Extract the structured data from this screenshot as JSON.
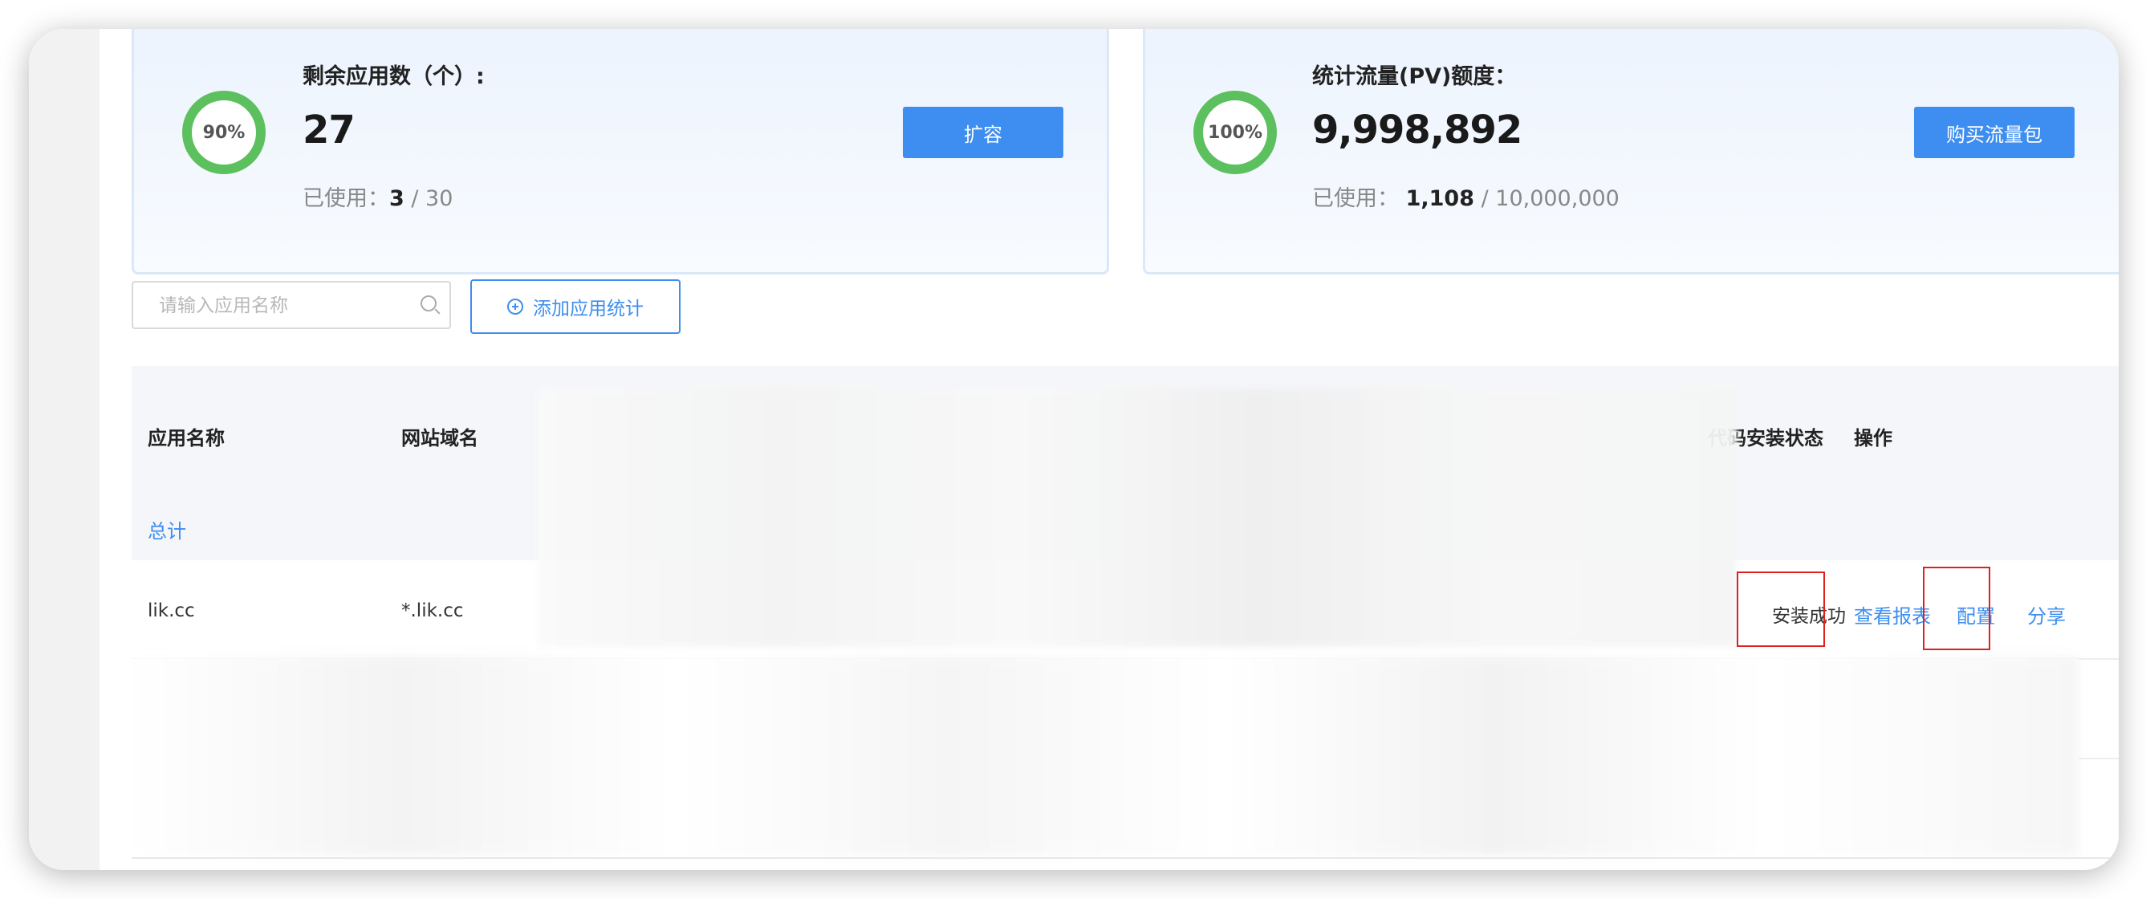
{
  "apps_card": {
    "percent": "90%",
    "title": "剩余应用数（个）:",
    "value": "27",
    "used_label": "已使用：",
    "used": "3",
    "total": " / 30",
    "button": "扩容"
  },
  "pv_card": {
    "percent": "100%",
    "title": "统计流量(PV)额度：",
    "value": "9,998,892",
    "used_label": "已使用：",
    "used": "1,108",
    "total": " / 10,000,000",
    "button": "购买流量包"
  },
  "toolbar": {
    "search_placeholder": "请输入应用名称",
    "add_button": "添加应用统计"
  },
  "table": {
    "headers": {
      "app_name": "应用名称",
      "domain": "网站域名",
      "install_status": "代码安装状态",
      "actions": "操作"
    },
    "total_label": "总计",
    "rows": [
      {
        "app_name": "lik.cc",
        "domain": "*.lik.cc",
        "status": "安装成功",
        "actions": {
          "report": "查看报表",
          "config": "配置",
          "share": "分享"
        }
      }
    ]
  },
  "colors": {
    "accent": "#3d8ef0",
    "ring": "#5cc05e",
    "highlight": "#e02020"
  }
}
